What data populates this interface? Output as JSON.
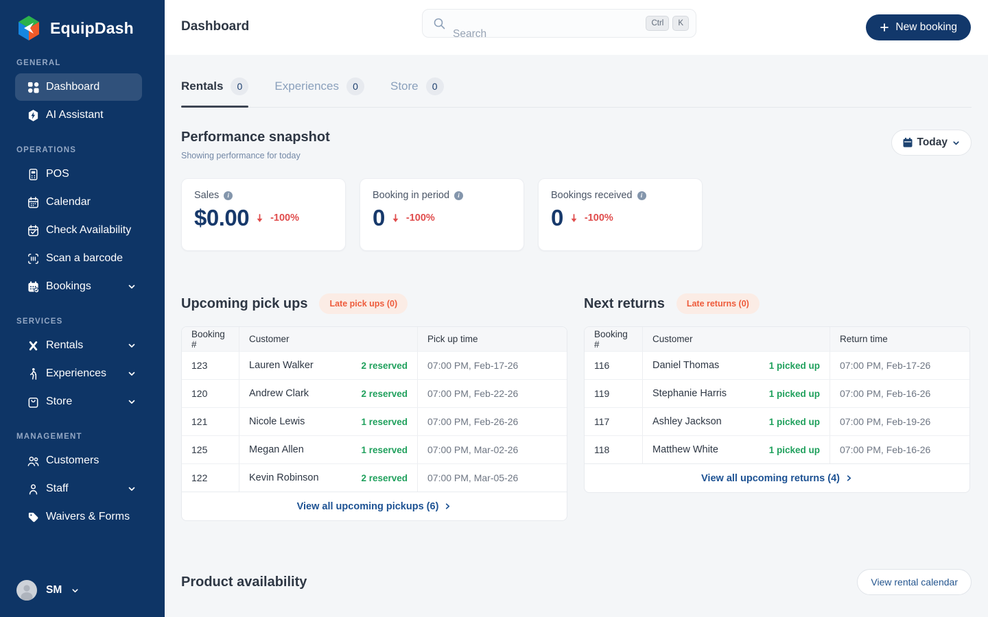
{
  "brand": {
    "name": "EquipDash",
    "navy": "#0E3566",
    "green": "#2BB24C",
    "blue": "#1686E0",
    "orange": "#F05A28"
  },
  "topbar": {
    "title": "Dashboard",
    "search_placeholder": "Search",
    "shortcut_ctrl": "Ctrl",
    "shortcut_k": "K",
    "new_booking_label": "New booking"
  },
  "sidebar": {
    "sections": [
      {
        "label": "GENERAL",
        "items": [
          {
            "label": "Dashboard",
            "icon": "grid-icon",
            "active": true
          },
          {
            "label": "AI Assistant",
            "icon": "ai-assistant-icon"
          }
        ]
      },
      {
        "label": "OPERATIONS",
        "items": [
          {
            "label": "POS",
            "icon": "pos-terminal-icon"
          },
          {
            "label": "Calendar",
            "icon": "calendar-icon"
          },
          {
            "label": "Check Availability",
            "icon": "calendar-check-icon"
          },
          {
            "label": "Scan a barcode",
            "icon": "barcode-scan-icon"
          },
          {
            "label": "Bookings",
            "icon": "bookings-calendar-icon",
            "chevron": true
          }
        ]
      },
      {
        "label": "SERVICES",
        "items": [
          {
            "label": "Rentals",
            "icon": "crossed-paddles-icon",
            "chevron": true
          },
          {
            "label": "Experiences",
            "icon": "hiker-icon",
            "chevron": true
          },
          {
            "label": "Store",
            "icon": "shopping-bag-icon",
            "chevron": true
          }
        ]
      },
      {
        "label": "MANAGEMENT",
        "items": [
          {
            "label": "Customers",
            "icon": "people-group-icon"
          },
          {
            "label": "Staff",
            "icon": "person-icon",
            "chevron": true
          },
          {
            "label": "Waivers & Forms",
            "icon": "tag-icon"
          }
        ]
      }
    ],
    "user": {
      "initials": "SM"
    }
  },
  "tabs": [
    {
      "label": "Rentals",
      "count": "0",
      "active": true
    },
    {
      "label": "Experiences",
      "count": "0",
      "active": false
    },
    {
      "label": "Store",
      "count": "0",
      "active": false
    }
  ],
  "performance": {
    "title": "Performance snapshot",
    "subtitle": "Showing performance for today",
    "period_label": "Today",
    "cards": [
      {
        "label": "Sales",
        "value": "$0.00",
        "delta": "-100%"
      },
      {
        "label": "Booking in period",
        "value": "0",
        "delta": "-100%"
      },
      {
        "label": "Bookings received",
        "value": "0",
        "delta": "-100%"
      }
    ]
  },
  "pickups": {
    "title": "Upcoming pick ups",
    "late_badge": "Late pick ups (0)",
    "headers": [
      "Booking #",
      "Customer",
      "Pick up time"
    ],
    "rows": [
      {
        "id": "123",
        "customer": "Lauren Walker",
        "status": "2 reserved",
        "time": "07:00 PM, Feb-17-26"
      },
      {
        "id": "120",
        "customer": "Andrew Clark",
        "status": "2 reserved",
        "time": "07:00 PM, Feb-22-26"
      },
      {
        "id": "121",
        "customer": "Nicole Lewis",
        "status": "1 reserved",
        "time": "07:00 PM, Feb-26-26"
      },
      {
        "id": "125",
        "customer": "Megan Allen",
        "status": "1 reserved",
        "time": "07:00 PM, Mar-02-26"
      },
      {
        "id": "122",
        "customer": "Kevin Robinson",
        "status": "2 reserved",
        "time": "07:00 PM, Mar-05-26"
      }
    ],
    "footer": "View all upcoming pickups (6)"
  },
  "returns": {
    "title": "Next returns",
    "late_badge": "Late returns (0)",
    "headers": [
      "Booking #",
      "Customer",
      "Return time"
    ],
    "rows": [
      {
        "id": "116",
        "customer": "Daniel Thomas",
        "status": "1 picked up",
        "time": "07:00 PM, Feb-17-26"
      },
      {
        "id": "119",
        "customer": "Stephanie Harris",
        "status": "1 picked up",
        "time": "07:00 PM, Feb-16-26"
      },
      {
        "id": "117",
        "customer": "Ashley Jackson",
        "status": "1 picked up",
        "time": "07:00 PM, Feb-19-26"
      },
      {
        "id": "118",
        "customer": "Matthew White",
        "status": "1 picked up",
        "time": "07:00 PM, Feb-16-26"
      }
    ],
    "footer": "View all upcoming returns (4)"
  },
  "availability": {
    "title": "Product availability",
    "button_label": "View rental calendar"
  }
}
